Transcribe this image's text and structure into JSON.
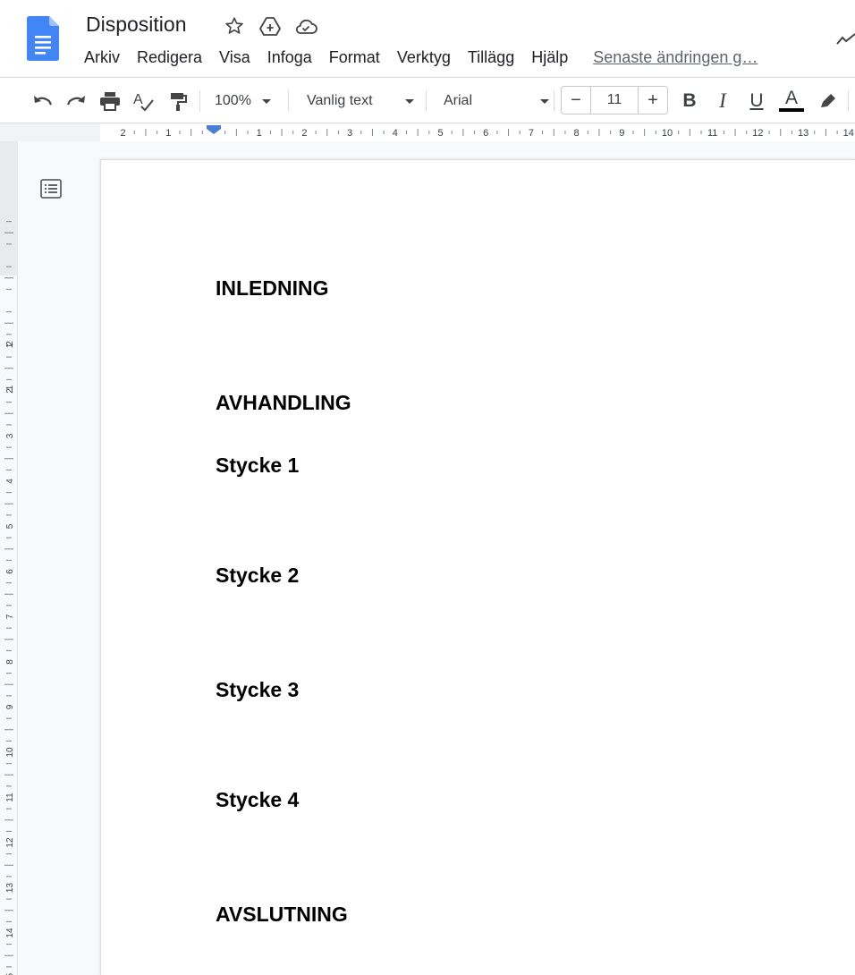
{
  "document": {
    "title": "Disposition"
  },
  "menu": {
    "items": [
      "Arkiv",
      "Redigera",
      "Visa",
      "Infoga",
      "Format",
      "Verktyg",
      "Tillägg",
      "Hjälp"
    ],
    "last_edit": "Senaste ändringen g…"
  },
  "toolbar": {
    "zoom": "100%",
    "style": "Vanlig text",
    "font": "Arial",
    "font_size_minus": "−",
    "font_size": "11",
    "font_size_plus": "+",
    "bold": "B",
    "italic": "I",
    "underline": "U",
    "text_color": "A"
  },
  "ruler": {
    "horizontal_labels": [
      "2",
      "1",
      "1",
      "2",
      "3",
      "4",
      "5",
      "6",
      "7",
      "8",
      "9",
      "10",
      "11",
      "12",
      "13",
      "14"
    ],
    "vertical_labels": [
      "2",
      "1",
      "1",
      "2",
      "3",
      "4",
      "5",
      "6",
      "7",
      "8",
      "9",
      "10",
      "11",
      "12",
      "13",
      "14",
      "15"
    ]
  },
  "content": {
    "headings": [
      "INLEDNING",
      "AVHANDLING",
      "Stycke 1",
      "Stycke 2",
      "Stycke 3",
      "Stycke 4",
      "AVSLUTNING"
    ]
  },
  "colors": {
    "docs_blue": "#4285f4",
    "ruler_marker": "#4a7fd6"
  }
}
